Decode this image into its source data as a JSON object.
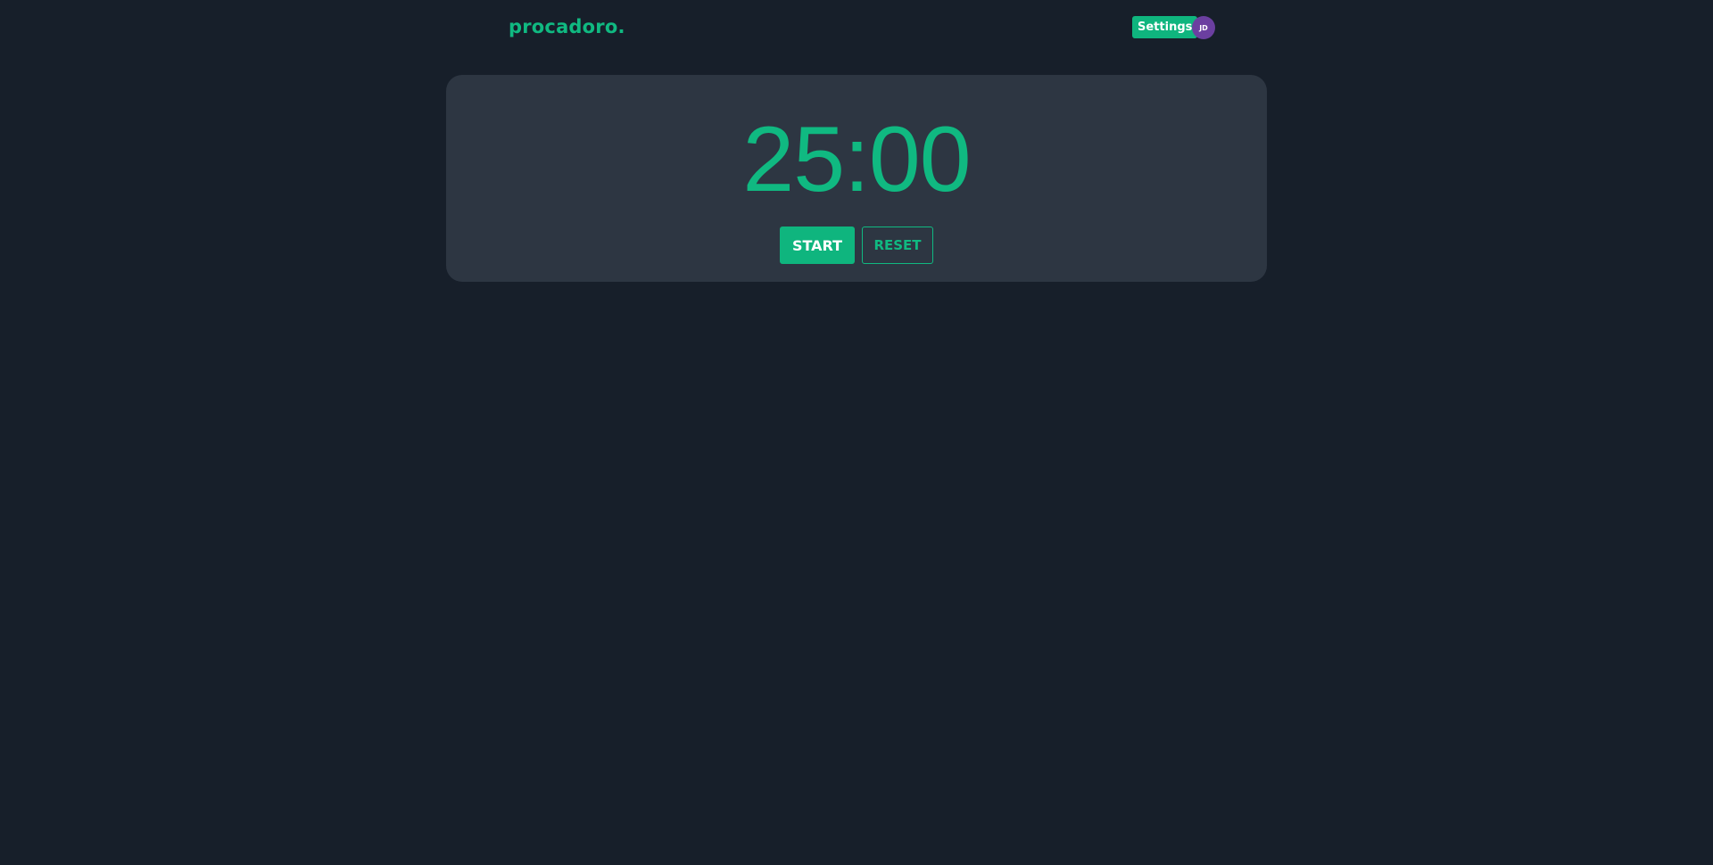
{
  "header": {
    "logo": "procadoro.",
    "settings_label": "Settings",
    "avatar_initials": "JD"
  },
  "timer": {
    "display": "25:00",
    "start_label": "START",
    "reset_label": "RESET"
  },
  "colors": {
    "background": "#171f2a",
    "card": "#2d3642",
    "accent": "#10b981",
    "avatar": "#6b3fa0"
  }
}
